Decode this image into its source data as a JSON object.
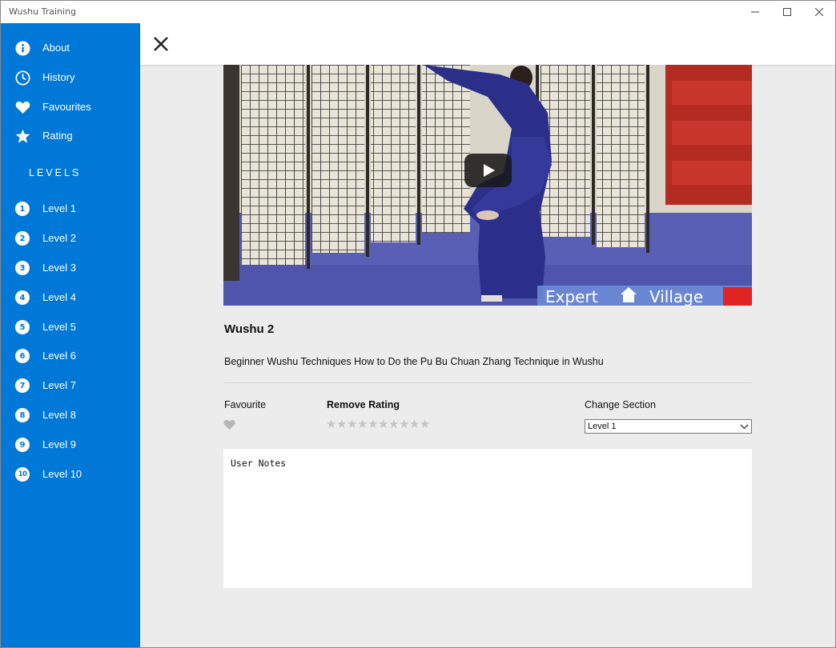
{
  "window": {
    "title": "Wushu Training",
    "controls": [
      "minimize-icon",
      "maximize-icon",
      "close-icon"
    ]
  },
  "sidebar": {
    "accent": "#0078d7",
    "menu": [
      {
        "label": "About",
        "icon": "info-icon"
      },
      {
        "label": "History",
        "icon": "clock-icon"
      },
      {
        "label": "Favourites",
        "icon": "heart-icon"
      },
      {
        "label": "Rating",
        "icon": "star-icon"
      }
    ],
    "levels_heading": "LEVELS",
    "levels": [
      {
        "num": "1",
        "label": "Level 1"
      },
      {
        "num": "2",
        "label": "Level 2"
      },
      {
        "num": "3",
        "label": "Level 3"
      },
      {
        "num": "4",
        "label": "Level 4"
      },
      {
        "num": "5",
        "label": "Level 5"
      },
      {
        "num": "6",
        "label": "Level 6"
      },
      {
        "num": "7",
        "label": "Level 7"
      },
      {
        "num": "8",
        "label": "Level 8"
      },
      {
        "num": "9",
        "label": "Level 9"
      },
      {
        "num": "10",
        "label": "Level 10"
      }
    ]
  },
  "header": {
    "close_icon": "close-x-icon"
  },
  "video": {
    "play_icon": "play-icon",
    "overlay_text": [
      "Expert",
      "Village"
    ]
  },
  "detail": {
    "title": "Wushu 2",
    "description": "Beginner Wushu Techniques How to Do the Pu Bu Chuan Zhang Technique in Wushu",
    "favourite_label": "Favourite",
    "favourite_active": false,
    "rating_label": "Remove Rating",
    "rating_max": 10,
    "rating_value": 0,
    "section_label": "Change Section",
    "section_selected": "Level 1",
    "notes_value": "User Notes"
  }
}
